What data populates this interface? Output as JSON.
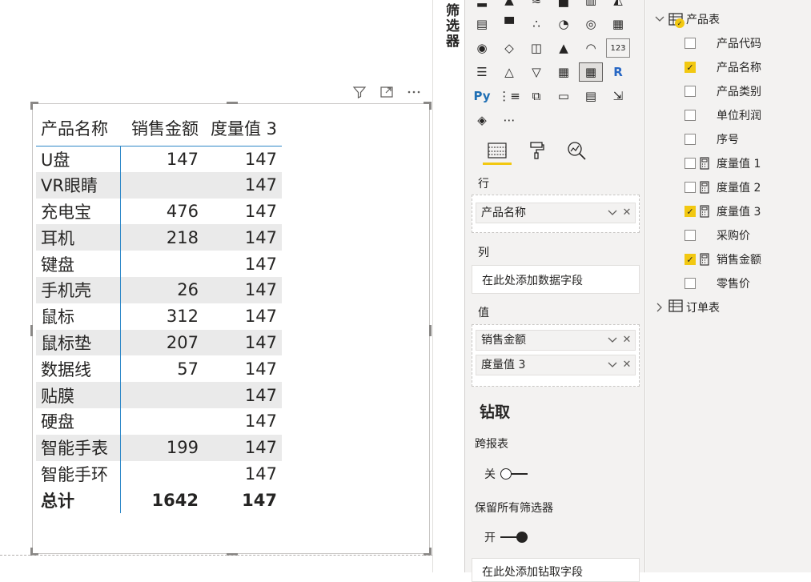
{
  "filters_pane": {
    "title": "筛选器"
  },
  "visual": {
    "headers": [
      "产品名称",
      "销售金额",
      "度量值 3"
    ],
    "rows": [
      {
        "name": "U盘",
        "sales": "147",
        "m3": "147"
      },
      {
        "name": "VR眼睛",
        "sales": "",
        "m3": "147"
      },
      {
        "name": "充电宝",
        "sales": "476",
        "m3": "147"
      },
      {
        "name": "耳机",
        "sales": "218",
        "m3": "147"
      },
      {
        "name": "键盘",
        "sales": "",
        "m3": "147"
      },
      {
        "name": "手机壳",
        "sales": "26",
        "m3": "147"
      },
      {
        "name": "鼠标",
        "sales": "312",
        "m3": "147"
      },
      {
        "name": "鼠标垫",
        "sales": "207",
        "m3": "147"
      },
      {
        "name": "数据线",
        "sales": "57",
        "m3": "147"
      },
      {
        "name": "贴膜",
        "sales": "",
        "m3": "147"
      },
      {
        "name": "硬盘",
        "sales": "",
        "m3": "147"
      },
      {
        "name": "智能手表",
        "sales": "199",
        "m3": "147"
      },
      {
        "name": "智能手环",
        "sales": "",
        "m3": "147"
      }
    ],
    "total": {
      "name": "总计",
      "sales": "1642",
      "m3": "147"
    }
  },
  "viz_pane": {
    "visual_icons": [
      "stacked-bar",
      "stacked-column",
      "clustered-bar",
      "clustered-column",
      "100-stacked-bar",
      "100-stacked-column",
      "ribbon",
      "waterfall",
      "scatter",
      "pie",
      "donut",
      "treemap",
      "map",
      "filled-map",
      "shape-map",
      "azure-map",
      "gauge",
      "card",
      "multi-row-card",
      "kpi",
      "slicer",
      "table",
      "matrix",
      "r-visual",
      "python-visual",
      "key-influencers",
      "decomposition-tree",
      "qa",
      "smart-narrative",
      "paginated-report",
      "power-apps",
      "more"
    ],
    "visual_glyphs": [
      "▂",
      "▲",
      "≋",
      "▟",
      "▥",
      "◭",
      "▤",
      "▀",
      "∴",
      "◔",
      "◎",
      "▦",
      "◉",
      "◇",
      "◫",
      "▲",
      "◠",
      "123",
      "☰",
      "△",
      "▽",
      "▦",
      "▦",
      "R",
      "Py",
      "⋮≡",
      "⧉",
      "▭",
      "▤",
      "⇲",
      "◈",
      "⋯"
    ],
    "selected_visual_index": 22,
    "rows_label": "行",
    "rows_field": "产品名称",
    "columns_label": "列",
    "columns_placeholder": "在此处添加数据字段",
    "values_label": "值",
    "values_fields": [
      "销售金额",
      "度量值 3"
    ],
    "drill_title": "钻取",
    "cross_report_label": "跨报表",
    "cross_report_state": "关",
    "keep_filters_label": "保留所有筛选器",
    "keep_filters_state": "开",
    "drill_placeholder": "在此处添加钻取字段"
  },
  "fields_pane": {
    "table1": "产品表",
    "fields": [
      {
        "name": "产品代码",
        "checked": false,
        "calc": false
      },
      {
        "name": "产品名称",
        "checked": true,
        "calc": false
      },
      {
        "name": "产品类别",
        "checked": false,
        "calc": false
      },
      {
        "name": "单位利润",
        "checked": false,
        "calc": false
      },
      {
        "name": "序号",
        "checked": false,
        "calc": false
      },
      {
        "name": "度量值 1",
        "checked": false,
        "calc": true
      },
      {
        "name": "度量值 2",
        "checked": false,
        "calc": true
      },
      {
        "name": "度量值 3",
        "checked": true,
        "calc": true
      },
      {
        "name": "采购价",
        "checked": false,
        "calc": false
      },
      {
        "name": "销售金额",
        "checked": true,
        "calc": true
      },
      {
        "name": "零售价",
        "checked": false,
        "calc": false
      }
    ],
    "table2": "订单表"
  },
  "colors": {
    "accent": "#f2c811",
    "matrix_line": "#2e88c8",
    "band": "#eaeaea",
    "python": "#1f6fb4",
    "r": "#2767c4"
  }
}
